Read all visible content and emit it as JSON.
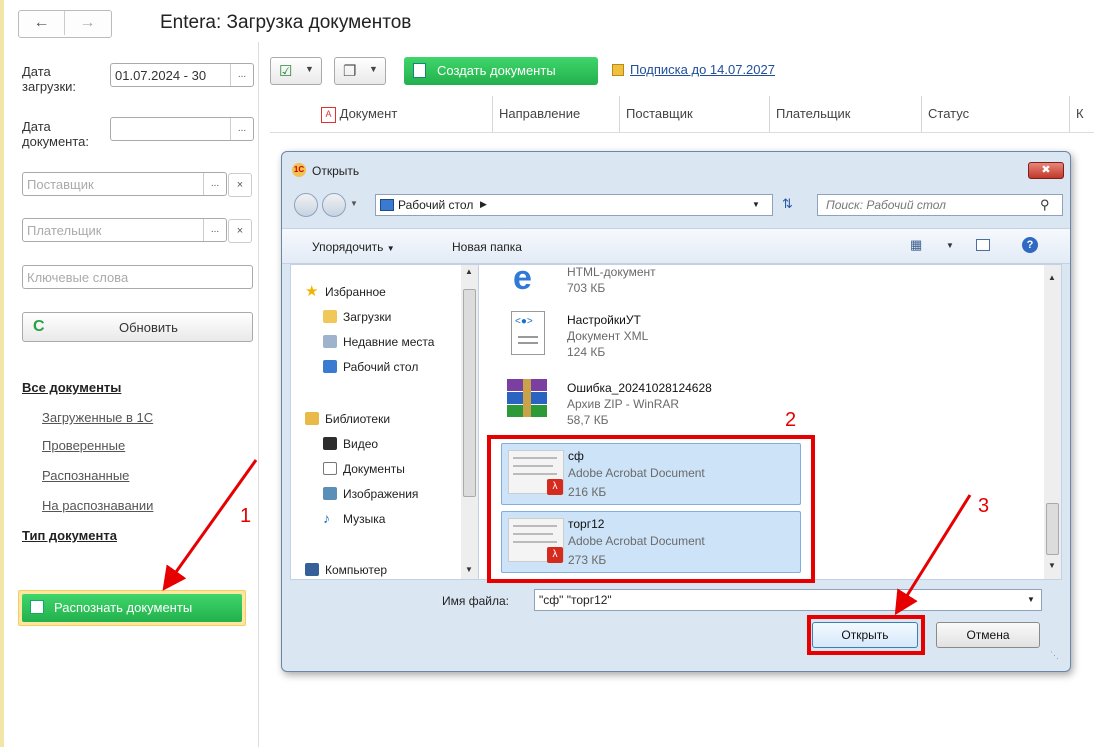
{
  "window": {
    "title": "Entera: Загрузка документов"
  },
  "filters": {
    "load_date_label": "Дата загрузки:",
    "load_date_value": "01.07.2024 - 30",
    "doc_date_label": "Дата документа:",
    "supplier_placeholder": "Поставщик",
    "payer_placeholder": "Плательщик",
    "keywords_placeholder": "Ключевые слова",
    "refresh_label": "Обновить"
  },
  "sidebar": {
    "all_docs": "Все документы",
    "items": [
      "Загруженные в 1С",
      "Проверенные",
      "Распознанные",
      "На распознавании"
    ],
    "doc_type": "Тип документа",
    "recognize_button": "Распознать документы"
  },
  "toolbar": {
    "create_docs": "Создать документы",
    "subscription": "Подписка до 14.07.2027"
  },
  "table": {
    "columns": [
      "Документ",
      "Направление",
      "Поставщик",
      "Плательщик",
      "Статус",
      "К"
    ]
  },
  "dialog": {
    "title": "Открыть",
    "breadcrumb": "Рабочий стол",
    "search_placeholder": "Поиск: Рабочий стол",
    "organize": "Упорядочить",
    "new_folder": "Новая папка",
    "nav": {
      "favorites": "Избранное",
      "favorites_items": [
        "Загрузки",
        "Недавние места",
        "Рабочий стол"
      ],
      "libraries": "Библиотеки",
      "library_items": [
        "Видео",
        "Документы",
        "Изображения",
        "Музыка"
      ],
      "computer": "Компьютер"
    },
    "files": [
      {
        "name": "",
        "type": "HTML-документ",
        "size": "703 КБ",
        "icon": "ie-html-icon"
      },
      {
        "name": "НастройкиУТ",
        "type": "Документ XML",
        "size": "124 КБ",
        "icon": "xml-icon"
      },
      {
        "name": "Ошибка_20241028124628",
        "type": "Архив ZIP - WinRAR",
        "size": "58,7 КБ",
        "icon": "winrar-icon"
      },
      {
        "name": "сф",
        "type": "Adobe Acrobat Document",
        "size": "216 КБ",
        "icon": "pdf-thumb-icon"
      },
      {
        "name": "торг12",
        "type": "Adobe Acrobat Document",
        "size": "273 КБ",
        "icon": "pdf-thumb-icon"
      }
    ],
    "filename_label": "Имя файла:",
    "filename_value": "\"сф\" \"торг12\"",
    "open_button": "Открыть",
    "cancel_button": "Отмена"
  },
  "annotations": [
    "1",
    "2",
    "3"
  ],
  "colors": {
    "green": "#2ec45a",
    "annotation_red": "#e60000",
    "selection": "#cde3f7"
  }
}
